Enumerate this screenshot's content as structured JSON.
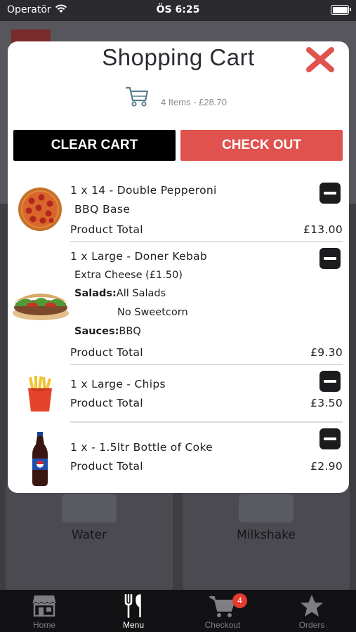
{
  "status_bar": {
    "carrier": "Operatör",
    "time": "ÖS 6:25"
  },
  "background": {
    "cards": [
      {
        "label": "Water"
      },
      {
        "label": "Milkshake"
      }
    ]
  },
  "cart": {
    "title": "Shopping Cart",
    "summary": "4 Items - £28.70",
    "clear_label": "CLEAR CART",
    "checkout_label": "CHECK OUT",
    "items": [
      {
        "name": "1 x 14 - Double Pepperoni",
        "option": "BBQ Base",
        "total_label": "Product Total",
        "price": "£13.00",
        "image": "pizza"
      },
      {
        "name": "1 x Large - Doner Kebab",
        "extra": "Extra Cheese (£1.50)",
        "salads_label": "Salads:",
        "salads_value": "All Salads",
        "salads_value2": "No Sweetcorn",
        "sauces_label": "Sauces:",
        "sauces_value": "BBQ",
        "total_label": "Product Total",
        "price": "£9.30",
        "image": "kebab"
      },
      {
        "name": "1 x Large - Chips",
        "total_label": "Product Total",
        "price": "£3.50",
        "image": "chips"
      },
      {
        "name": "1 x - 1.5ltr Bottle of Coke",
        "total_label": "Product Total",
        "price": "£2.90",
        "image": "cola-bottle"
      }
    ]
  },
  "tabbar": {
    "tabs": [
      {
        "label": "Home",
        "icon": "store-icon"
      },
      {
        "label": "Menu",
        "icon": "cutlery-icon"
      },
      {
        "label": "Checkout",
        "icon": "cart-icon"
      },
      {
        "label": "Orders",
        "icon": "star-icon"
      }
    ],
    "active": "Menu",
    "checkout_badge": "4"
  },
  "colors": {
    "accent": "#e0524e",
    "clear_button": "#000000",
    "close": "#e0524e"
  }
}
